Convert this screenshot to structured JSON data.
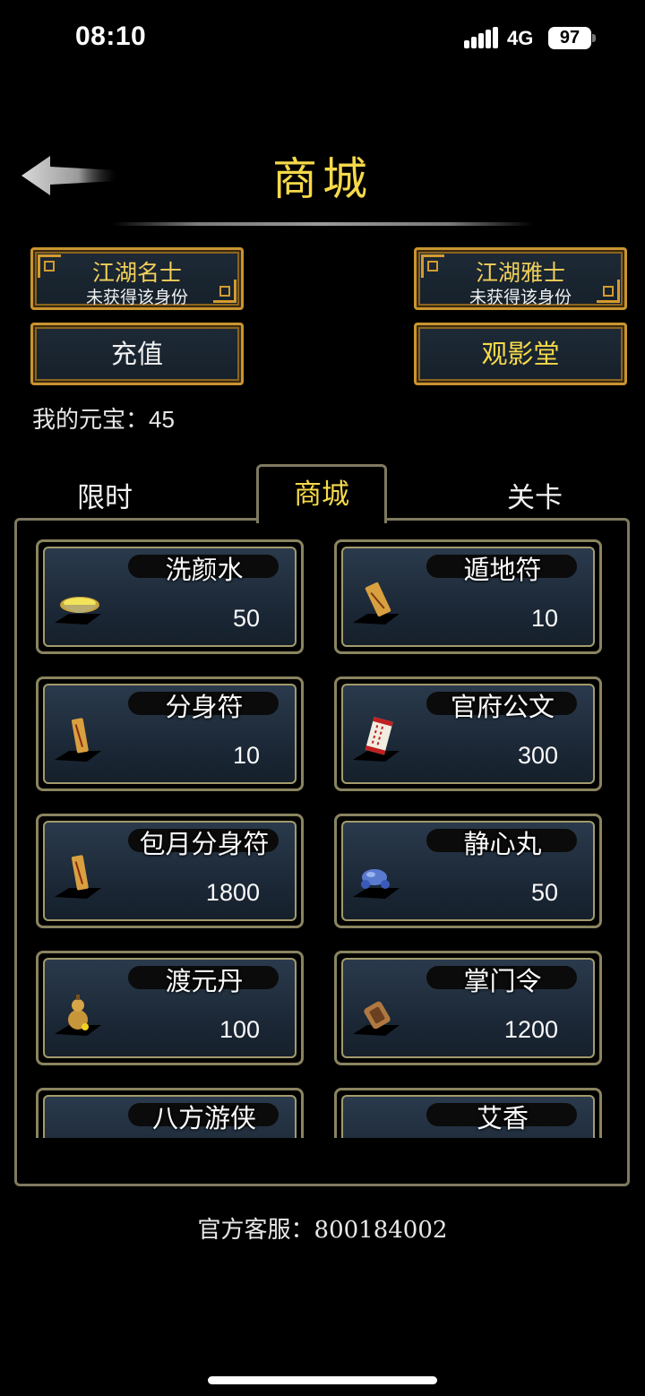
{
  "status_bar": {
    "time": "08:10",
    "network": "4G",
    "battery": "97"
  },
  "header": {
    "title": "商城",
    "back_icon": "arrow-left-icon"
  },
  "identities": [
    {
      "title": "江湖名士",
      "status": "未获得该身份"
    },
    {
      "title": "江湖雅士",
      "status": "未获得该身份"
    }
  ],
  "actions": {
    "recharge": "充值",
    "theater": "观影堂"
  },
  "currency": {
    "label": "我的元宝：",
    "value": "45"
  },
  "tabs": [
    {
      "label": "限时",
      "active": false
    },
    {
      "label": "商城",
      "active": true
    },
    {
      "label": "关卡",
      "active": false
    }
  ],
  "items": [
    {
      "name": "洗颜水",
      "price": "50",
      "icon": "bowl-icon"
    },
    {
      "name": "遁地符",
      "price": "10",
      "icon": "talisman-icon"
    },
    {
      "name": "分身符",
      "price": "10",
      "icon": "talisman-icon"
    },
    {
      "name": "官府公文",
      "price": "300",
      "icon": "document-icon"
    },
    {
      "name": "包月分身符",
      "price": "1800",
      "icon": "talisman-icon"
    },
    {
      "name": "静心丸",
      "price": "50",
      "icon": "pill-icon"
    },
    {
      "name": "渡元丹",
      "price": "100",
      "icon": "gourd-icon"
    },
    {
      "name": "掌门令",
      "price": "1200",
      "icon": "token-icon"
    },
    {
      "name": "八方游侠",
      "price": "",
      "icon": "badge-icon"
    },
    {
      "name": "艾香",
      "price": "",
      "icon": "incense-icon"
    }
  ],
  "footer": {
    "support": "官方客服：800184002"
  },
  "colors": {
    "gold": "#f6d94a",
    "frame": "#c99430",
    "panel_border": "#7f7a60",
    "card_bg": "#1a2634"
  }
}
